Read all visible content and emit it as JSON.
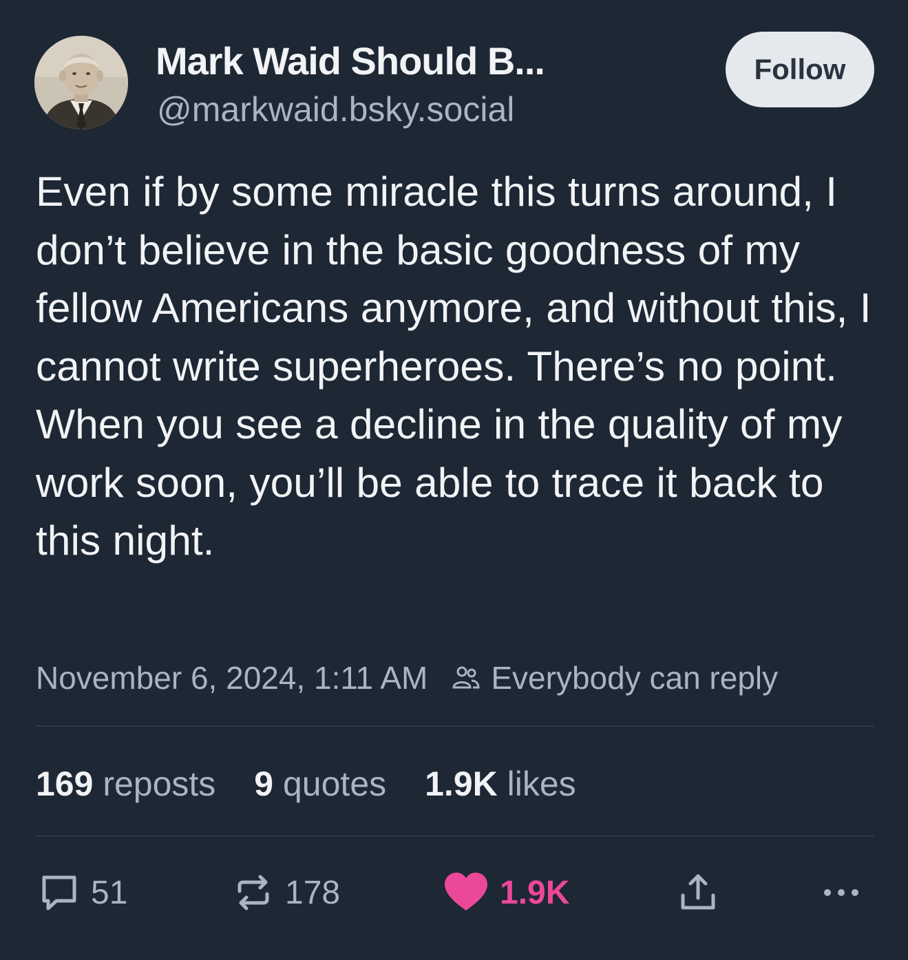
{
  "author": {
    "display_name": "Mark Waid Should B...",
    "handle": "@markwaid.bsky.social"
  },
  "follow_label": "Follow",
  "post": {
    "text": "Even if by some miracle this turns around, I don’t believe in the basic goodness of my fellow Americans anymore, and without this, I cannot write superheroes. There’s no point. When you see a decline in the quality of my work soon, you’ll be able to trace it back to this night.",
    "timestamp": "November 6, 2024, 1:11 AM",
    "reply_setting": "Everybody can reply"
  },
  "stats": {
    "reposts_num": "169",
    "reposts_label": " reposts",
    "quotes_num": "9",
    "quotes_label": " quotes",
    "likes_num": "1.9K",
    "likes_label": " likes"
  },
  "actions": {
    "reply_count": "51",
    "repost_count": "178",
    "like_count": "1.9K"
  },
  "icons": {
    "reply": "speech-bubble-icon",
    "repost": "repost-arrows-icon",
    "like": "heart-icon",
    "share": "share-icon",
    "more": "ellipsis-icon",
    "reply_setting": "people-icon"
  },
  "colors": {
    "background": "#1e2734",
    "like_accent": "#ec4899",
    "follow_button_bg": "#e5e9ee"
  }
}
